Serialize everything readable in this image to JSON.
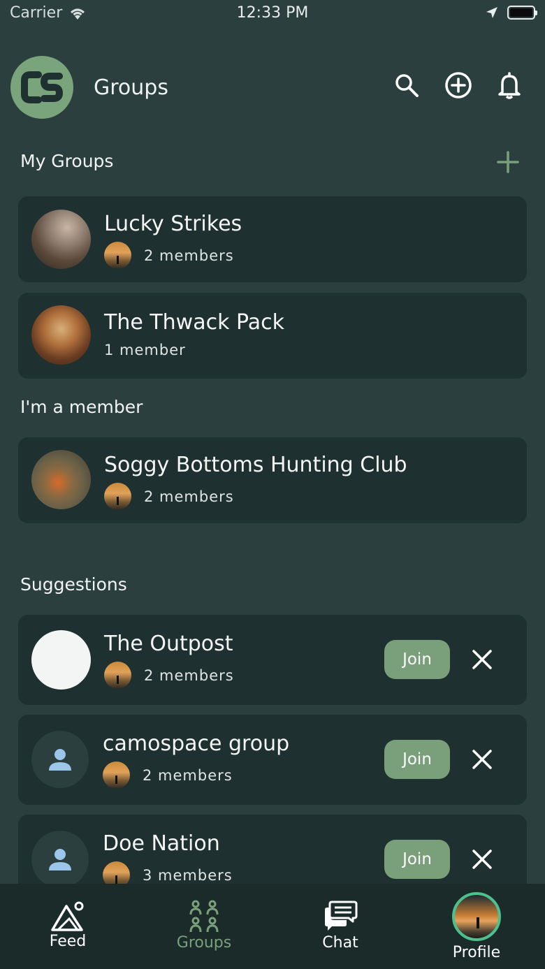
{
  "status_bar": {
    "carrier": "Carrier",
    "time": "12:33 PM"
  },
  "header": {
    "title": "Groups",
    "logo_text": "CS",
    "icons": [
      "search-icon",
      "add-circle-icon",
      "bell-icon"
    ]
  },
  "sections": {
    "my_groups": "My Groups",
    "member": "I'm a member",
    "suggestions": "Suggestions"
  },
  "my_groups": [
    {
      "name": "Lucky Strikes",
      "members": "2 members",
      "show_mini_avatar": true
    },
    {
      "name": "The Thwack Pack",
      "members": "1 member",
      "show_mini_avatar": false
    }
  ],
  "member_groups": [
    {
      "name": "Soggy Bottoms Hunting Club",
      "members": "2 members",
      "show_mini_avatar": true
    }
  ],
  "suggestions": [
    {
      "name": "The Outpost",
      "members": "2 members",
      "join_label": "Join"
    },
    {
      "name": "camospace group",
      "members": "2 members",
      "join_label": "Join"
    },
    {
      "name": "Doe Nation",
      "members": "3 members",
      "join_label": "Join"
    }
  ],
  "tabs": [
    {
      "label": "Feed",
      "icon": "mountain-icon",
      "active": false
    },
    {
      "label": "Groups",
      "icon": "groups-icon",
      "active": true
    },
    {
      "label": "Chat",
      "icon": "chat-icon",
      "active": false
    },
    {
      "label": "Profile",
      "icon": "profile-avatar",
      "active": false
    }
  ],
  "colors": {
    "background": "#2a3f3e",
    "card": "#1e302f",
    "accent": "#7aa07b",
    "tabbar": "#1a2b2a"
  }
}
